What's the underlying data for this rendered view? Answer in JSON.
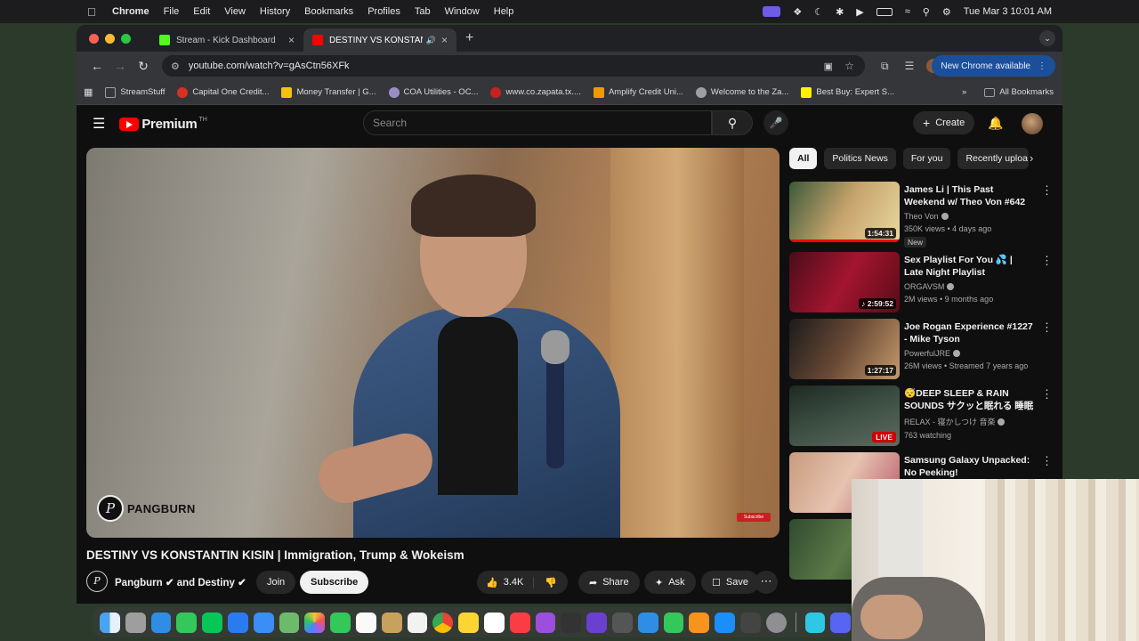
{
  "menubar": {
    "app": "Chrome",
    "items": [
      "File",
      "Edit",
      "View",
      "History",
      "Bookmarks",
      "Profiles",
      "Tab",
      "Window",
      "Help"
    ],
    "clock": "Tue Mar 3  10:01 AM"
  },
  "browser": {
    "tabs": [
      {
        "title": "Stream - Kick Dashboard",
        "favicon_color": "#53fc18"
      },
      {
        "title": "DESTINY VS KONSTANTIN",
        "favicon_color": "#ff0000"
      }
    ],
    "url": "youtube.com/watch?v=gAsCtn56XFk",
    "new_chrome_label": "New Chrome available",
    "bookmarks": [
      {
        "label": "StreamStuff",
        "color": "#9aa0a6"
      },
      {
        "label": "Capital One Credit...",
        "color": "#d93025"
      },
      {
        "label": "Money Transfer | G...",
        "color": "#f4c20d"
      },
      {
        "label": "COA Utilities - OC...",
        "color": "#9b8ec4"
      },
      {
        "label": "www.co.zapata.tx....",
        "color": "#c5221f"
      },
      {
        "label": "Amplify Credit Uni...",
        "color": "#f29900"
      },
      {
        "label": "Welcome to the Za...",
        "color": "#9aa0a6"
      },
      {
        "label": "Best Buy: Expert S...",
        "color": "#fff200"
      }
    ],
    "all_bookmarks_label": "All Bookmarks"
  },
  "youtube": {
    "logo_text": "Premium",
    "logo_sup": "TH",
    "search_placeholder": "Search",
    "create_label": "Create",
    "watermark": "PANGBURN",
    "watermark_logo": "P",
    "subscribe_badge": "Subscribe",
    "video_title": "DESTINY VS KONSTANTIN KISIN | Immigration, Trump & Wokeism",
    "channel_text": "Pangburn ✔ and Destiny ✔",
    "join_label": "Join",
    "subscribe_label": "Subscribe",
    "like_count": "3.4K",
    "share_label": "Share",
    "ask_label": "Ask",
    "save_label": "Save",
    "chips": [
      "All",
      "Politics News",
      "For you",
      "Recently uploa"
    ],
    "recommendations": [
      {
        "title": "James Li | This Past Weekend w/ Theo Von #642",
        "channel": "Theo Von",
        "meta": "350K views • 4 days ago",
        "badge": "New",
        "duration": "1:54:31",
        "thumb": "linear-gradient(120deg,#3b5a3a,#c7a36c 50%,#e8d9a0)"
      },
      {
        "title": "Sex Playlist For You 💦 | Late Night Playlist",
        "channel": "ORGAVSM",
        "meta": "2M views • 9 months ago",
        "badge": "",
        "duration": "♪ 2:59:52",
        "thumb": "linear-gradient(120deg,#4a0d1a,#a3152f 50%,#5a0b18)"
      },
      {
        "title": "Joe Rogan Experience #1227 - Mike Tyson",
        "channel": "PowerfulJRE",
        "meta": "26M views • Streamed 7 years ago",
        "badge": "",
        "duration": "1:27:17",
        "thumb": "linear-gradient(120deg,#1b1b1b,#6a4a36 50%,#c49a6c)"
      },
      {
        "title": "😴DEEP SLEEP & RAIN SOUNDS サクッと眠れる 睡眠用BGM...",
        "channel": "RELAX - 寝かしつけ 音楽",
        "meta": "763 watching",
        "badge": "",
        "duration": "LIVE",
        "thumb": "linear-gradient(160deg,#1e2a24,#3d4f44 50%,#5e6b60)"
      },
      {
        "title": "Samsung Galaxy Unpacked: No Peeking!",
        "channel": "",
        "meta": "",
        "badge": "",
        "duration": "",
        "thumb": "linear-gradient(120deg,#c89b7d,#e6c3b0 50%,#b85a6a)"
      },
      {
        "title": "",
        "channel": "",
        "meta": "",
        "badge": "",
        "duration": "",
        "thumb": "linear-gradient(120deg,#2f4a2e,#5b7a48 50%,#243b24)"
      }
    ]
  },
  "dock": {
    "apps": [
      "finder",
      "launchpad",
      "safari",
      "messages",
      "line",
      "messenger",
      "mail",
      "maps",
      "photos",
      "facetime",
      "calendar",
      "notes",
      "reminders",
      "chrome",
      "notes2",
      "freeform",
      "music",
      "podcasts",
      "activity",
      "pages",
      "editor",
      "keynote",
      "numbers",
      "pages2",
      "appstore",
      "calculator",
      "settings",
      "app",
      "discord"
    ]
  }
}
